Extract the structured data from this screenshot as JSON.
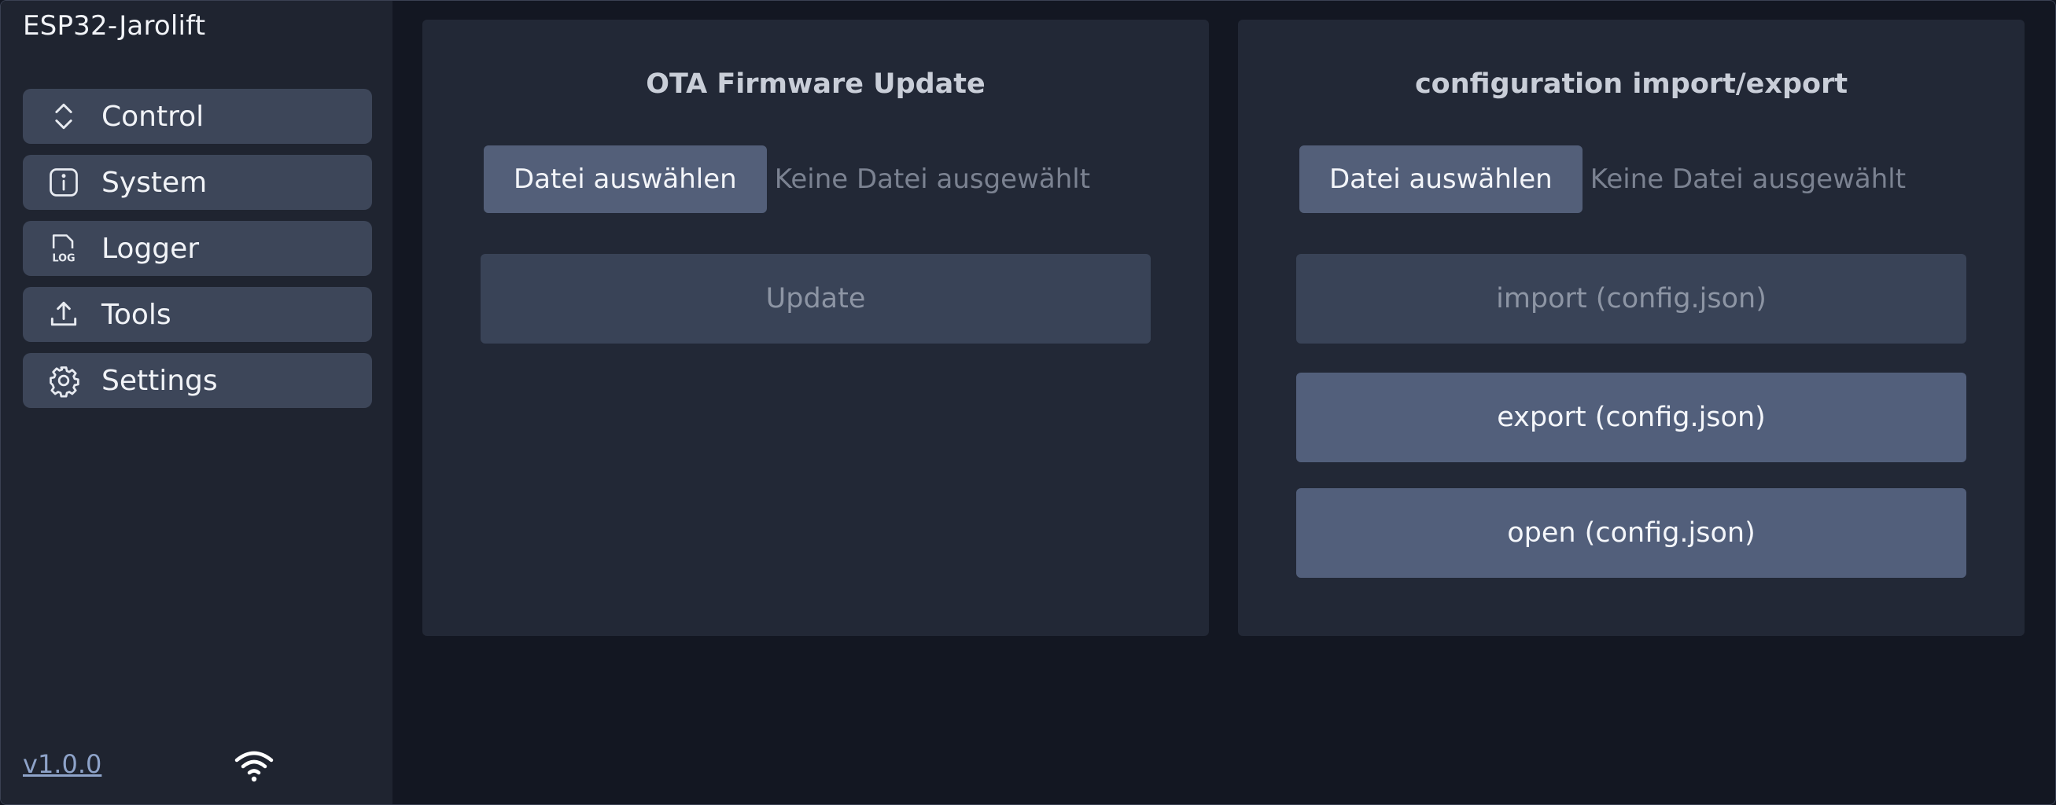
{
  "app": {
    "title": "ESP32-Jarolift",
    "version": "v1.0.0"
  },
  "sidebar": {
    "items": [
      {
        "label": "Control",
        "icon": "chevron-up-down-icon"
      },
      {
        "label": "System",
        "icon": "info-icon"
      },
      {
        "label": "Logger",
        "icon": "log-file-icon"
      },
      {
        "label": "Tools",
        "icon": "upload-icon"
      },
      {
        "label": "Settings",
        "icon": "gear-icon"
      }
    ],
    "status_icon": "wifi-icon"
  },
  "ota": {
    "title": "OTA Firmware Update",
    "file_button": "Datei auswählen",
    "file_status": "Keine Datei ausgewählt",
    "update_button": "Update"
  },
  "config": {
    "title": "configuration import/export",
    "file_button": "Datei auswählen",
    "file_status": "Keine Datei ausgewählt",
    "import_button": "import (config.json)",
    "export_button": "export (config.json)",
    "open_button": "open (config.json)"
  },
  "colors": {
    "background": "#131722",
    "sidebar": "#1f2430",
    "panel": "#222836",
    "nav_item": "#3d4659",
    "button_active": "#525f7b",
    "button_disabled": "#394357",
    "link": "#8ea3c9"
  }
}
